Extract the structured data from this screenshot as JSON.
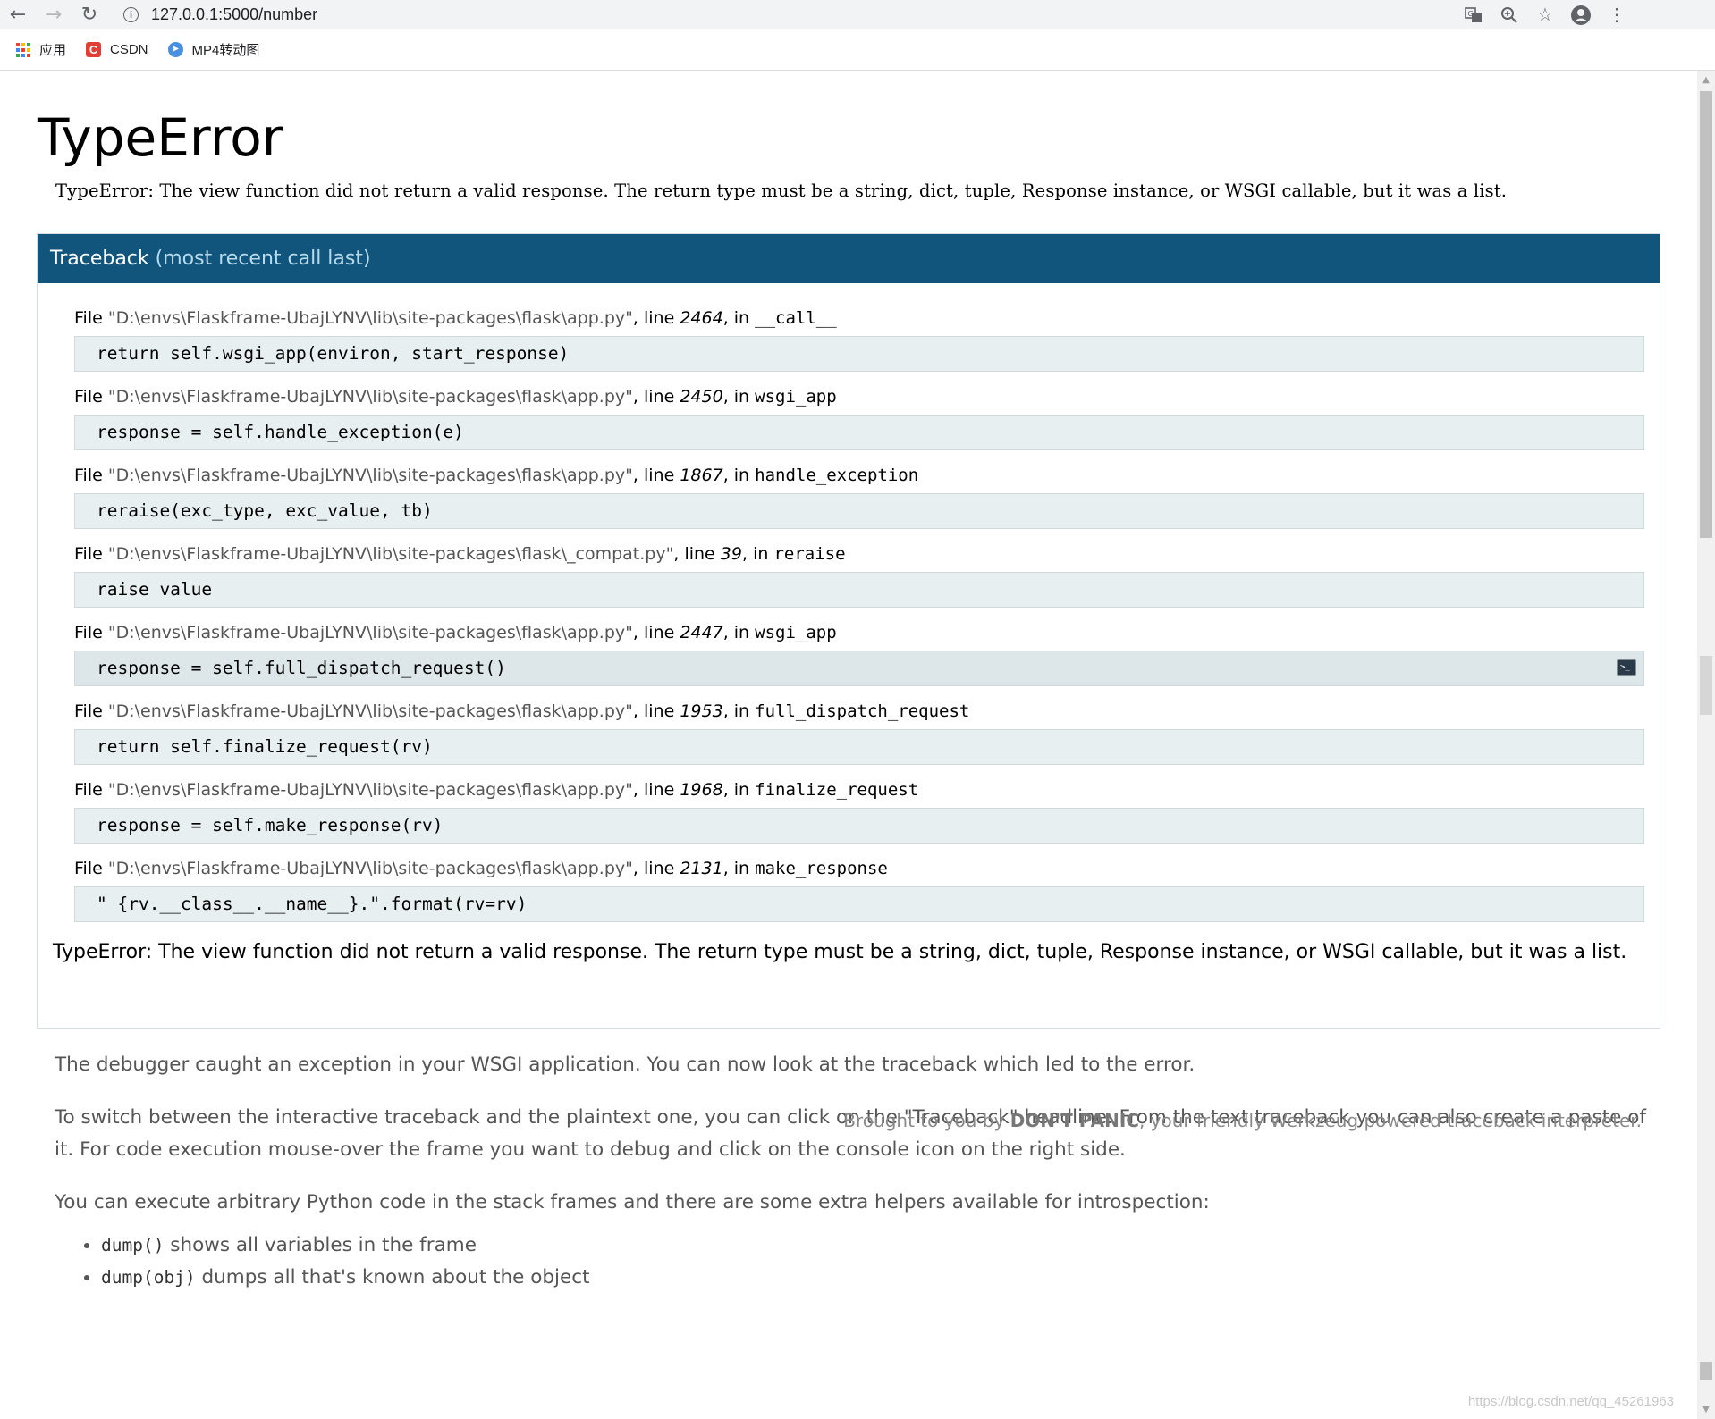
{
  "browser": {
    "url": "127.0.0.1:5000/number",
    "bookmarks": [
      {
        "label": "应用",
        "icon": "apps-grid-icon"
      },
      {
        "label": "CSDN",
        "icon": "csdn-icon"
      },
      {
        "label": "MP4转动图",
        "icon": "mp4-icon"
      }
    ]
  },
  "page": {
    "title": "TypeError",
    "error_mono": "TypeError: The view function did not return a valid response. The return type must be a string, dict, tuple, Response instance, or WSGI callable, but it was a list.",
    "traceback_title": "Traceback",
    "traceback_subtitle": "(most recent call last)",
    "frames": [
      {
        "file": "\"D:\\envs\\Flaskframe-UbajLYNV\\lib\\site-packages\\flask\\app.py\"",
        "line": "2464",
        "func": "__call__",
        "code": "return self.wsgi_app(environ, start_response)"
      },
      {
        "file": "\"D:\\envs\\Flaskframe-UbajLYNV\\lib\\site-packages\\flask\\app.py\"",
        "line": "2450",
        "func": "wsgi_app",
        "code": "response = self.handle_exception(e)"
      },
      {
        "file": "\"D:\\envs\\Flaskframe-UbajLYNV\\lib\\site-packages\\flask\\app.py\"",
        "line": "1867",
        "func": "handle_exception",
        "code": "reraise(exc_type, exc_value, tb)"
      },
      {
        "file": "\"D:\\envs\\Flaskframe-UbajLYNV\\lib\\site-packages\\flask\\_compat.py\"",
        "line": "39",
        "func": "reraise",
        "code": "raise value"
      },
      {
        "file": "\"D:\\envs\\Flaskframe-UbajLYNV\\lib\\site-packages\\flask\\app.py\"",
        "line": "2447",
        "func": "wsgi_app",
        "code": "response = self.full_dispatch_request()"
      },
      {
        "file": "\"D:\\envs\\Flaskframe-UbajLYNV\\lib\\site-packages\\flask\\app.py\"",
        "line": "1953",
        "func": "full_dispatch_request",
        "code": "return self.finalize_request(rv)"
      },
      {
        "file": "\"D:\\envs\\Flaskframe-UbajLYNV\\lib\\site-packages\\flask\\app.py\"",
        "line": "1968",
        "func": "finalize_request",
        "code": "response = self.make_response(rv)"
      },
      {
        "file": "\"D:\\envs\\Flaskframe-UbajLYNV\\lib\\site-packages\\flask\\app.py\"",
        "line": "2131",
        "func": "make_response",
        "code": "\" {rv.__class__.__name__}.\".format(rv=rv)"
      }
    ],
    "file_label": "File",
    "line_label": "line",
    "in_label": "in",
    "final_error": "TypeError: The view function did not return a valid response. The return type must be a string, dict, tuple, Response instance, or WSGI callable, but it was a list.",
    "explain_p1": "The debugger caught an exception in your WSGI application. You can now look at the traceback which led to the error.",
    "explain_p2": "To switch between the interactive traceback and the plaintext one, you can click on the \"Traceback\" headline. From the text traceback you can also create a paste of it. For code execution mouse-over the frame you want to debug and click on the console icon on the right side.",
    "explain_p3": "You can execute arbitrary Python code in the stack frames and there are some extra helpers available for introspection:",
    "helpers": [
      {
        "code": "dump()",
        "text": "shows all variables in the frame"
      },
      {
        "code": "dump(obj)",
        "text": "dumps all that's known about the object"
      }
    ],
    "footer_prefix": "Brought to you by",
    "footer_strong": "DON'T PANIC",
    "footer_suffix": ", your friendly Werkzeug powered traceback interpreter.",
    "watermark": "https://blog.csdn.net/qq_45261963"
  },
  "colors": {
    "traceback_header": "#11557c",
    "code_bg": "#e8eff0"
  }
}
